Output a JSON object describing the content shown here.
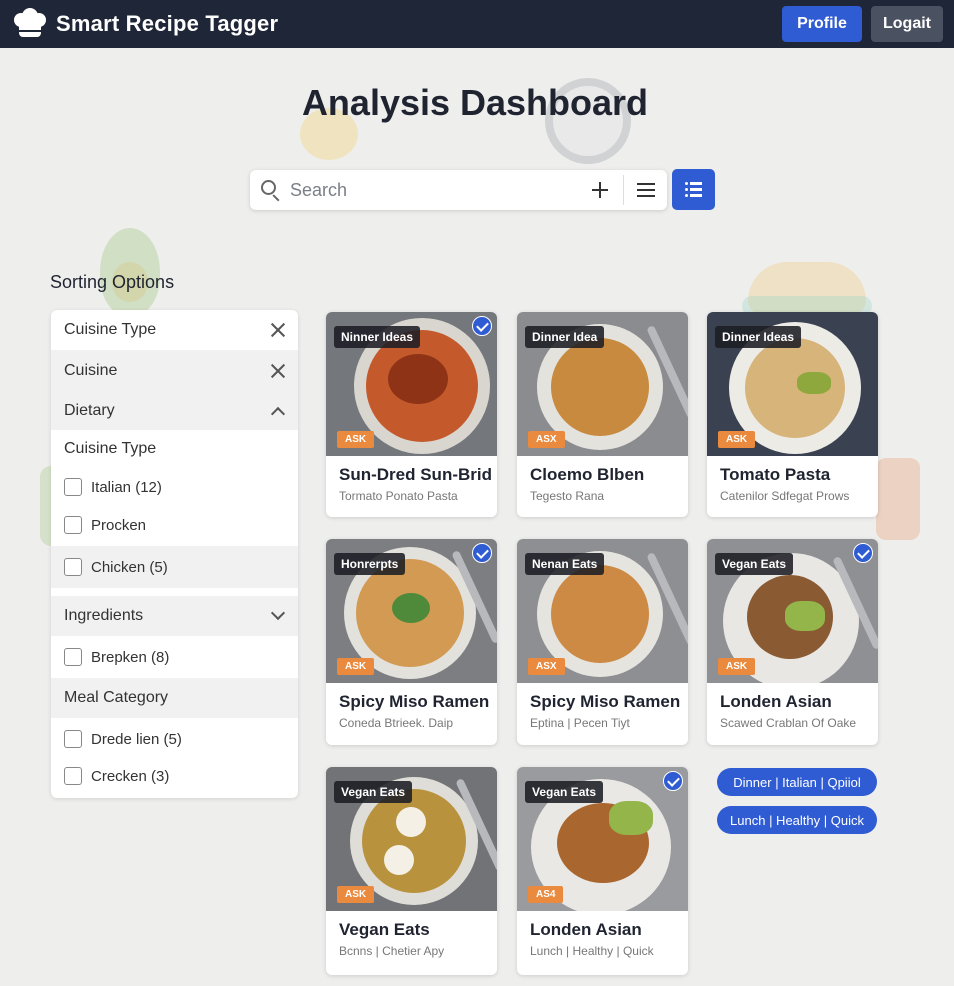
{
  "app": {
    "title": "Smart Recipe Tagger"
  },
  "header": {
    "profile_label": "Profile",
    "logout_label": "Logait"
  },
  "page": {
    "title": "Analysis Dashboard"
  },
  "search": {
    "placeholder": "Search"
  },
  "sidebar": {
    "title": "Sorting Options",
    "cuisine_type_1": "Cuisine Type",
    "cuisine": "Cuisine",
    "dietary": "Dietary",
    "cuisine_type_2": "Cuisine Type",
    "options_cuisine": [
      "Italian (12)",
      "Procken",
      "Chicken (5)"
    ],
    "ingredients": "Ingredients",
    "options_ingredients": [
      "Brepken (8)"
    ],
    "meal_category": "Meal Category",
    "options_meal": [
      "Drede lien (5)",
      "Crecken (3)"
    ]
  },
  "cards": [
    {
      "tag": "Ninner Ideas",
      "ask": "ASK",
      "title": "Sun-Dred Sun-Brid",
      "subtitle": "Tormato Ponato Pasta",
      "checked": true
    },
    {
      "tag": "Dinner Idea",
      "ask": "ASX",
      "title": "Cloemo Blben",
      "subtitle": "Tegesto Rana",
      "checked": false
    },
    {
      "tag": "Dinner Ideas",
      "ask": "ASK",
      "title": "Tomato Pasta",
      "subtitle": "Catenilor Sdfegat Prows",
      "checked": false
    },
    {
      "tag": "Honrerpts",
      "ask": "ASK",
      "title": "Spicy Miso Ramen",
      "subtitle": "Coneda Btrieek. Daip",
      "checked": true
    },
    {
      "tag": "Nenan Eats",
      "ask": "ASX",
      "title": "Spicy Miso Ramen",
      "subtitle": "Eptina | Pecen Tiyt",
      "checked": false
    },
    {
      "tag": "Vegan Eats",
      "ask": "ASK",
      "title": "Londen Asian",
      "subtitle": "Scawed Crablan Of Oake",
      "checked": true
    },
    {
      "tag": "Vegan Eats",
      "ask": "ASK",
      "title": "Vegan Eats",
      "subtitle": "Bcnns | Chetier Apy",
      "checked": false
    },
    {
      "tag": "Vegan Eats",
      "ask": "AS4",
      "title": "Londen Asian",
      "subtitle": "Lunch | Healthy | Quick",
      "checked": true
    }
  ],
  "meal_tags": [
    "Dinner | Italian | Qpiiol",
    "Lunch | Healthy | Quick"
  ],
  "colors": {
    "nav": "#1f2637",
    "accent": "#2f5bd3",
    "ask": "#e98a3e"
  }
}
